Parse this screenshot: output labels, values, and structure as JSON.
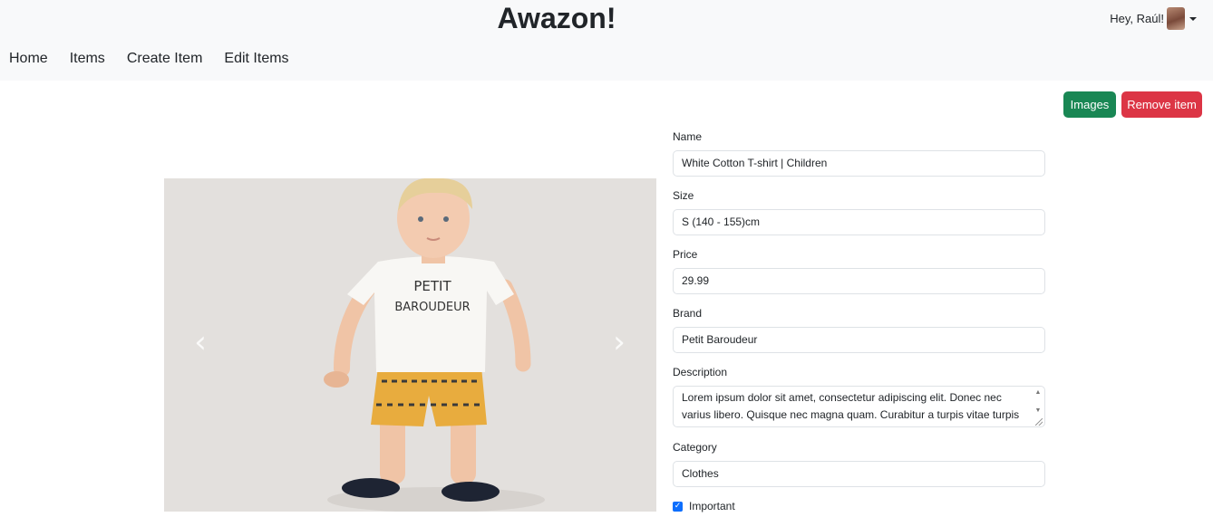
{
  "app": {
    "title": "Awazon!"
  },
  "user": {
    "greeting": "Hey, Raúl!"
  },
  "nav": {
    "items": [
      "Home",
      "Items",
      "Create Item",
      "Edit Items"
    ]
  },
  "actions": {
    "images_label": "Images",
    "remove_label": "Remove item"
  },
  "carousel": {
    "prev_icon": "chevron-left-icon",
    "next_icon": "chevron-right-icon",
    "prev_glyph": "‹",
    "next_glyph": "›"
  },
  "form": {
    "name": {
      "label": "Name",
      "value": "White Cotton T-shirt | Children"
    },
    "size": {
      "label": "Size",
      "value": "S (140 - 155)cm"
    },
    "price": {
      "label": "Price",
      "value": "29.99"
    },
    "brand": {
      "label": "Brand",
      "value": "Petit Baroudeur"
    },
    "description": {
      "label": "Description",
      "value": "Lorem ipsum dolor sit amet, consectetur adipiscing elit. Donec nec varius libero. Quisque nec magna quam. Curabitur a turpis vitae turpis"
    },
    "category": {
      "label": "Category",
      "value": "Clothes"
    },
    "important": {
      "label": "Important",
      "checked": true,
      "glyph": "✓"
    }
  },
  "colors": {
    "success": "#198754",
    "danger": "#dc3545",
    "primary": "#0d6efd",
    "navbar": "#f8f9fa"
  }
}
